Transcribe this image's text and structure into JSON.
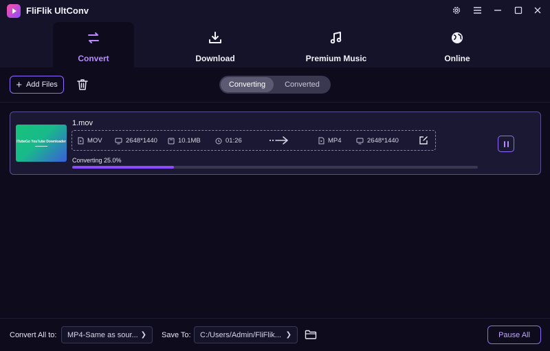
{
  "app": {
    "title": "FliFlik UltConv"
  },
  "window_controls": [
    "settings-icon",
    "menu-icon",
    "minimize-icon",
    "maximize-icon",
    "close-icon"
  ],
  "nav": {
    "tabs": [
      {
        "label": "Convert",
        "icon": "convert-icon",
        "active": true
      },
      {
        "label": "Download",
        "icon": "download-icon",
        "active": false
      },
      {
        "label": "Premium Music",
        "icon": "music-note-icon",
        "active": false
      },
      {
        "label": "Online",
        "icon": "globe-icon",
        "active": false
      }
    ]
  },
  "toolbar": {
    "add_files_label": "Add Files",
    "segments": {
      "converting": "Converting",
      "converted": "Converted",
      "selected": "Converting"
    }
  },
  "file": {
    "name": "1.mov",
    "thumbnail_text": "iTubeGo YouTube Downloader",
    "source": {
      "format": "MOV",
      "resolution": "2648*1440",
      "size": "10.1MB",
      "duration": "01:26"
    },
    "target": {
      "format": "MP4",
      "resolution": "2648*1440"
    },
    "progress_text": "Converting 25.0%",
    "progress": 0.25
  },
  "footer": {
    "convert_all_label": "Convert All to:",
    "convert_all_value": "MP4-Same as sour...",
    "save_to_label": "Save To:",
    "save_to_value": "C:/Users/Admin/FliFlik...",
    "pause_all_label": "Pause All"
  },
  "colors": {
    "accent": "#8f6cff",
    "accent_text": "#b98bff",
    "progress": "#8a4bff",
    "background": "#0d0b1c"
  }
}
